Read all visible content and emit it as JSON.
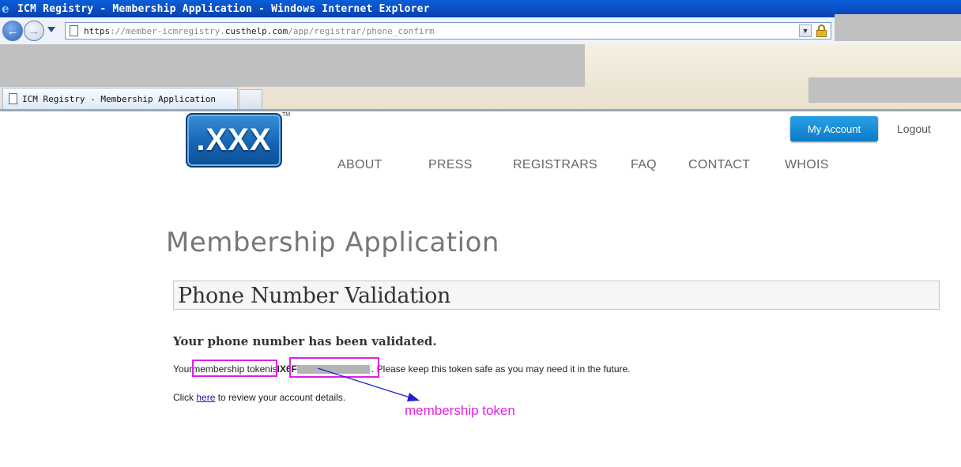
{
  "browser": {
    "window_title": "ICM Registry - Membership Application - Windows Internet Explorer",
    "url_prefix": "https",
    "url_sep": "://member-icmregistry.",
    "url_domain": "custhelp.com",
    "url_path": "/app/registrar/phone_confirm",
    "tab_title": "ICM Registry - Membership Application"
  },
  "header": {
    "logo_text": ".XXX",
    "trademark": "TM",
    "my_account": "My Account",
    "logout": "Logout",
    "nav": [
      "ABOUT",
      "PRESS",
      "REGISTRARS",
      "FAQ",
      "CONTACT",
      "WHOIS"
    ]
  },
  "content": {
    "page_title": "Membership Application",
    "section_title": "Phone Number Validation",
    "validated_message": "Your phone number has been validated.",
    "token_intro": "Your ",
    "token_label": "membership token",
    "token_is": " is ",
    "token_value_visible": "IX6F",
    "token_suffix": ". Please keep this token safe as you may need it in the future.",
    "click_prefix": "Click ",
    "here_link": "here",
    "click_suffix": " to review your account details."
  },
  "annotations": {
    "callout": "membership token",
    "highlight_color": "#e020e0",
    "arrow_color": "#2222cc"
  }
}
